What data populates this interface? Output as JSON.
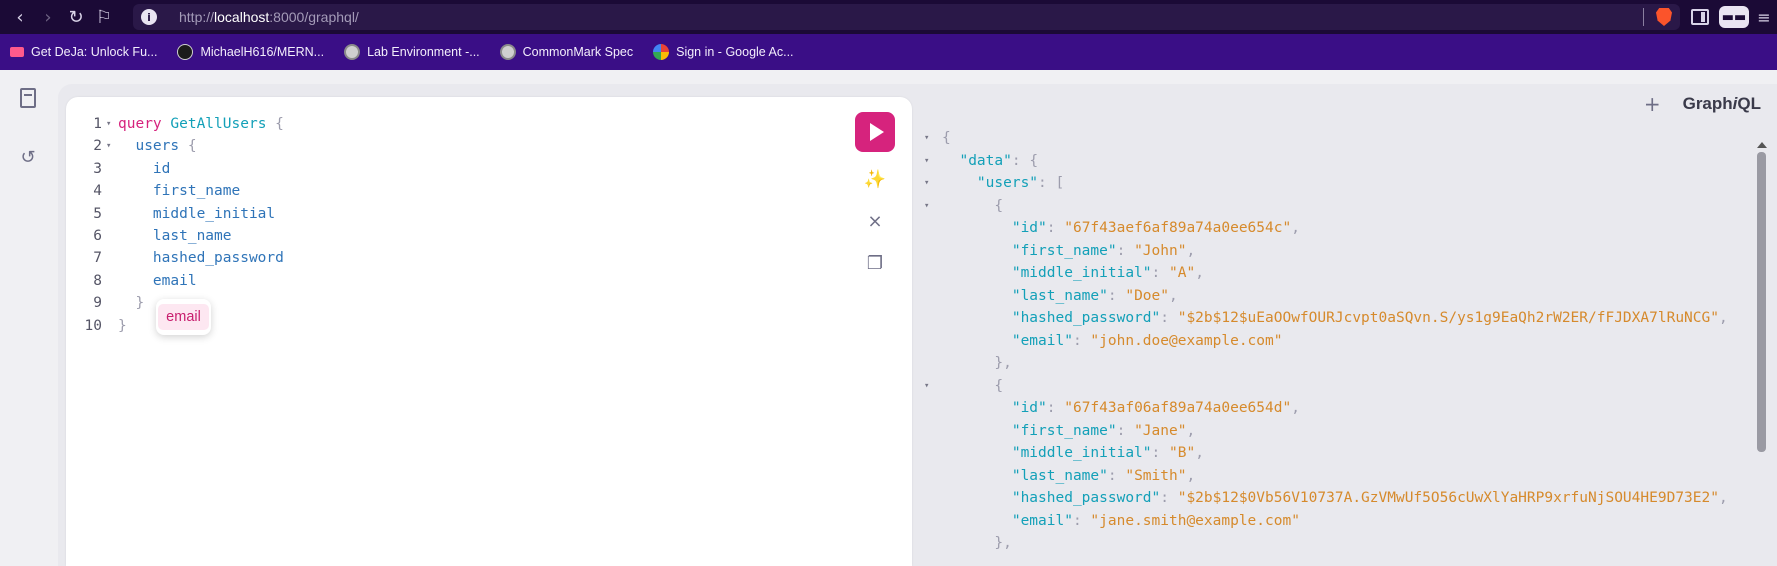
{
  "browser": {
    "url_prefix": "http://",
    "url_host": "localhost",
    "url_suffix": ":8000/graphql/",
    "back_icon": "chevron-left",
    "forward_icon": "chevron-right",
    "reload_icon": "reload",
    "bookmark_icon": "bookmark",
    "info_icon": "i"
  },
  "bookmarks": [
    {
      "label": "Get DeJa: Unlock Fu...",
      "icon": "deja-icon"
    },
    {
      "label": "MichaelH616/MERN...",
      "icon": "github-icon"
    },
    {
      "label": "Lab Environment -...",
      "icon": "globe-icon"
    },
    {
      "label": "CommonMark Spec",
      "icon": "globe-icon"
    },
    {
      "label": "Sign in - Google Ac...",
      "icon": "google-icon"
    }
  ],
  "editor": {
    "lines": [
      {
        "num": "1",
        "fold": true,
        "tokens": [
          {
            "t": "query ",
            "c": "kw"
          },
          {
            "t": "GetAllUsers ",
            "c": "opname"
          },
          {
            "t": "{",
            "c": "punc"
          }
        ]
      },
      {
        "num": "2",
        "fold": true,
        "tokens": [
          {
            "t": "  users ",
            "c": "field"
          },
          {
            "t": "{",
            "c": "punc"
          }
        ]
      },
      {
        "num": "3",
        "fold": false,
        "tokens": [
          {
            "t": "    id",
            "c": "field"
          }
        ]
      },
      {
        "num": "4",
        "fold": false,
        "tokens": [
          {
            "t": "    first_name",
            "c": "field"
          }
        ]
      },
      {
        "num": "5",
        "fold": false,
        "tokens": [
          {
            "t": "    middle_initial",
            "c": "field"
          }
        ]
      },
      {
        "num": "6",
        "fold": false,
        "tokens": [
          {
            "t": "    last_name",
            "c": "field"
          }
        ]
      },
      {
        "num": "7",
        "fold": false,
        "tokens": [
          {
            "t": "    hashed_password",
            "c": "field"
          }
        ]
      },
      {
        "num": "8",
        "fold": false,
        "tokens": [
          {
            "t": "    email",
            "c": "field"
          }
        ]
      },
      {
        "num": "9",
        "fold": false,
        "tokens": [
          {
            "t": "  }",
            "c": "punc"
          }
        ]
      },
      {
        "num": "10",
        "fold": false,
        "tokens": [
          {
            "t": "}",
            "c": "punc"
          }
        ]
      }
    ],
    "autocomplete_item": "email"
  },
  "results": {
    "logo_prefix": "Graph",
    "logo_italic": "i",
    "logo_suffix": "QL",
    "plus": "+",
    "lines": [
      {
        "fold": true,
        "indent": "",
        "parts": [
          {
            "t": "{",
            "c": "jp"
          }
        ]
      },
      {
        "fold": true,
        "indent": "  ",
        "parts": [
          {
            "t": "\"data\"",
            "c": "jkey"
          },
          {
            "t": ": {",
            "c": "jp"
          }
        ]
      },
      {
        "fold": true,
        "indent": "    ",
        "parts": [
          {
            "t": "\"users\"",
            "c": "jkey"
          },
          {
            "t": ": [",
            "c": "jp"
          }
        ]
      },
      {
        "fold": true,
        "indent": "      ",
        "parts": [
          {
            "t": "{",
            "c": "jp"
          }
        ]
      },
      {
        "fold": false,
        "indent": "        ",
        "parts": [
          {
            "t": "\"id\"",
            "c": "jkey"
          },
          {
            "t": ": ",
            "c": "jp"
          },
          {
            "t": "\"67f43aef6af89a74a0ee654c\"",
            "c": "jstr"
          },
          {
            "t": ",",
            "c": "jp"
          }
        ]
      },
      {
        "fold": false,
        "indent": "        ",
        "parts": [
          {
            "t": "\"first_name\"",
            "c": "jkey"
          },
          {
            "t": ": ",
            "c": "jp"
          },
          {
            "t": "\"John\"",
            "c": "jstr"
          },
          {
            "t": ",",
            "c": "jp"
          }
        ]
      },
      {
        "fold": false,
        "indent": "        ",
        "parts": [
          {
            "t": "\"middle_initial\"",
            "c": "jkey"
          },
          {
            "t": ": ",
            "c": "jp"
          },
          {
            "t": "\"A\"",
            "c": "jstr"
          },
          {
            "t": ",",
            "c": "jp"
          }
        ]
      },
      {
        "fold": false,
        "indent": "        ",
        "parts": [
          {
            "t": "\"last_name\"",
            "c": "jkey"
          },
          {
            "t": ": ",
            "c": "jp"
          },
          {
            "t": "\"Doe\"",
            "c": "jstr"
          },
          {
            "t": ",",
            "c": "jp"
          }
        ]
      },
      {
        "fold": false,
        "indent": "        ",
        "parts": [
          {
            "t": "\"hashed_password\"",
            "c": "jkey"
          },
          {
            "t": ": ",
            "c": "jp"
          },
          {
            "t": "\"$2b$12$uEaOOwfOURJcvpt0aSQvn.S/ys1g9EaQh2rW2ER/fFJDXA7lRuNCG\"",
            "c": "jstr"
          },
          {
            "t": ",",
            "c": "jp"
          }
        ]
      },
      {
        "fold": false,
        "indent": "        ",
        "parts": [
          {
            "t": "\"email\"",
            "c": "jkey"
          },
          {
            "t": ": ",
            "c": "jp"
          },
          {
            "t": "\"john.doe@example.com\"",
            "c": "jstr"
          }
        ]
      },
      {
        "fold": false,
        "indent": "      ",
        "parts": [
          {
            "t": "},",
            "c": "jp"
          }
        ]
      },
      {
        "fold": true,
        "indent": "      ",
        "parts": [
          {
            "t": "{",
            "c": "jp"
          }
        ]
      },
      {
        "fold": false,
        "indent": "        ",
        "parts": [
          {
            "t": "\"id\"",
            "c": "jkey"
          },
          {
            "t": ": ",
            "c": "jp"
          },
          {
            "t": "\"67f43af06af89a74a0ee654d\"",
            "c": "jstr"
          },
          {
            "t": ",",
            "c": "jp"
          }
        ]
      },
      {
        "fold": false,
        "indent": "        ",
        "parts": [
          {
            "t": "\"first_name\"",
            "c": "jkey"
          },
          {
            "t": ": ",
            "c": "jp"
          },
          {
            "t": "\"Jane\"",
            "c": "jstr"
          },
          {
            "t": ",",
            "c": "jp"
          }
        ]
      },
      {
        "fold": false,
        "indent": "        ",
        "parts": [
          {
            "t": "\"middle_initial\"",
            "c": "jkey"
          },
          {
            "t": ": ",
            "c": "jp"
          },
          {
            "t": "\"B\"",
            "c": "jstr"
          },
          {
            "t": ",",
            "c": "jp"
          }
        ]
      },
      {
        "fold": false,
        "indent": "        ",
        "parts": [
          {
            "t": "\"last_name\"",
            "c": "jkey"
          },
          {
            "t": ": ",
            "c": "jp"
          },
          {
            "t": "\"Smith\"",
            "c": "jstr"
          },
          {
            "t": ",",
            "c": "jp"
          }
        ]
      },
      {
        "fold": false,
        "indent": "        ",
        "parts": [
          {
            "t": "\"hashed_password\"",
            "c": "jkey"
          },
          {
            "t": ": ",
            "c": "jp"
          },
          {
            "t": "\"$2b$12$0Vb56V10737A.GzVMwUf5O56cUwXlYaHRP9xrfuNjSOU4HE9D73E2\"",
            "c": "jstr"
          },
          {
            "t": ",",
            "c": "jp"
          }
        ]
      },
      {
        "fold": false,
        "indent": "        ",
        "parts": [
          {
            "t": "\"email\"",
            "c": "jkey"
          },
          {
            "t": ": ",
            "c": "jp"
          },
          {
            "t": "\"jane.smith@example.com\"",
            "c": "jstr"
          }
        ]
      },
      {
        "fold": false,
        "indent": "      ",
        "parts": [
          {
            "t": "},",
            "c": "jp"
          }
        ]
      }
    ]
  },
  "colors": {
    "accent": "#d6237d",
    "keyword": "#d6237d",
    "operation_name": "#13a0b8",
    "field": "#2f74b8",
    "json_string": "#d68a2c",
    "bookmarks_bar": "#3a0e86"
  }
}
